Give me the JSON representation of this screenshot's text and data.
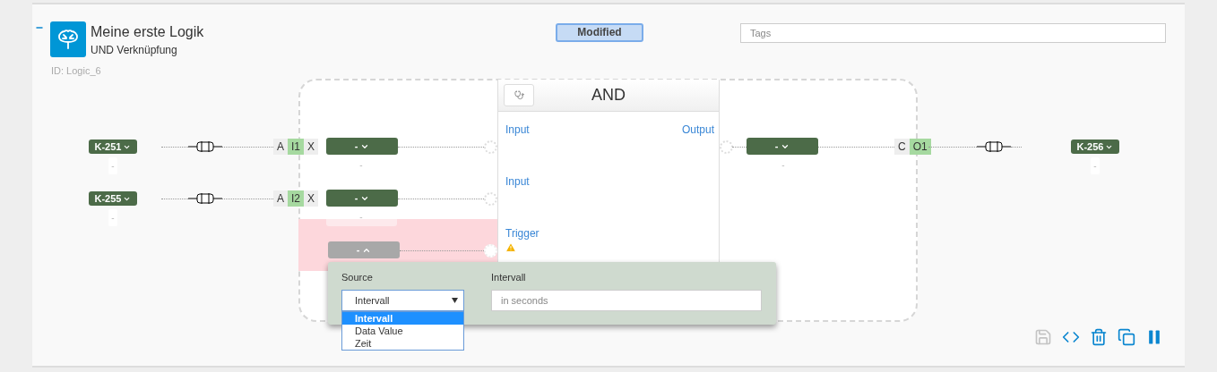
{
  "header": {
    "expanded": true,
    "title": "Meine erste Logik",
    "subtitle": "UND Verknüpfung",
    "id_label": "ID: Logic_6",
    "status": "Modified",
    "tags_placeholder": "Tags"
  },
  "block": {
    "title": "AND",
    "rows": [
      {
        "left": "Input",
        "right": "Output",
        "warning": false
      },
      {
        "left": "Input",
        "warning": false
      },
      {
        "left": "Trigger",
        "warning": true
      }
    ]
  },
  "inputs": [
    {
      "channel": "K-251",
      "channel_value": "-",
      "mode": "A",
      "port": "I1",
      "clear": "X",
      "selector": "-",
      "selector_value": "-"
    },
    {
      "channel": "K-255",
      "channel_value": "-",
      "mode": "A",
      "port": "I2",
      "clear": "X",
      "selector": "-",
      "selector_value": "-"
    }
  ],
  "trigger": {
    "selector": "-",
    "expanded": true,
    "error": true
  },
  "output": {
    "selector": "-",
    "selector_value": "-",
    "mode": "C",
    "port": "O1",
    "channel": "K-256",
    "channel_value": "-"
  },
  "popup": {
    "source_label": "Source",
    "source_value": "Intervall",
    "options": [
      {
        "label": "Intervall",
        "selected": true
      },
      {
        "label": "Data Value",
        "selected": false
      },
      {
        "label": "Zeit",
        "selected": false
      }
    ],
    "interval_label": "Intervall",
    "interval_placeholder": "in seconds"
  },
  "toolbar": [
    {
      "kind": "save",
      "disabled": true
    },
    {
      "kind": "code",
      "disabled": false
    },
    {
      "kind": "delete",
      "disabled": false
    },
    {
      "kind": "copy",
      "disabled": false
    },
    {
      "kind": "pause",
      "disabled": false
    }
  ]
}
